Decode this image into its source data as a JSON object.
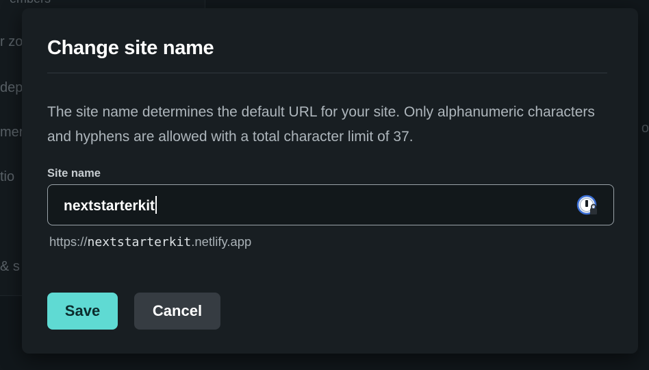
{
  "background": {
    "fragments": [
      "embers",
      "r zo",
      "dep",
      "mer",
      "tio",
      "& s"
    ],
    "right_fragment": "o"
  },
  "modal": {
    "title": "Change site name",
    "description": "The site name determines the default URL for your site. Only alphanumeric characters and hyphens are allowed with a total character limit of 37.",
    "field": {
      "label": "Site name",
      "value": "nextstarterkit",
      "password_manager_icon": "password-manager-icon"
    },
    "url_hint": {
      "prefix": "https://",
      "site": "nextstarterkit",
      "suffix": ".netlify.app"
    },
    "buttons": {
      "save": "Save",
      "cancel": "Cancel"
    }
  },
  "colors": {
    "accent": "#5fdad3",
    "modal_bg": "#181e22",
    "cancel_bg": "#363c42"
  }
}
